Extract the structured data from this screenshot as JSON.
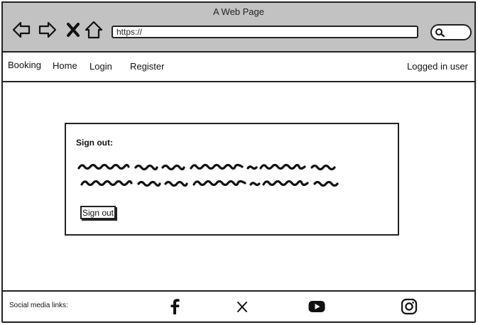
{
  "browser": {
    "title": "A Web Page",
    "url": "https://"
  },
  "nav": {
    "booking": "Booking",
    "home": "Home",
    "login": "Login",
    "register": "Register",
    "user_status": "Logged in user"
  },
  "panel": {
    "title": "Sign out:",
    "button_label": "Sign out"
  },
  "footer": {
    "social_label": "Social media links:",
    "social_icons": [
      "facebook-icon",
      "x-icon",
      "youtube-icon",
      "instagram-icon"
    ]
  }
}
